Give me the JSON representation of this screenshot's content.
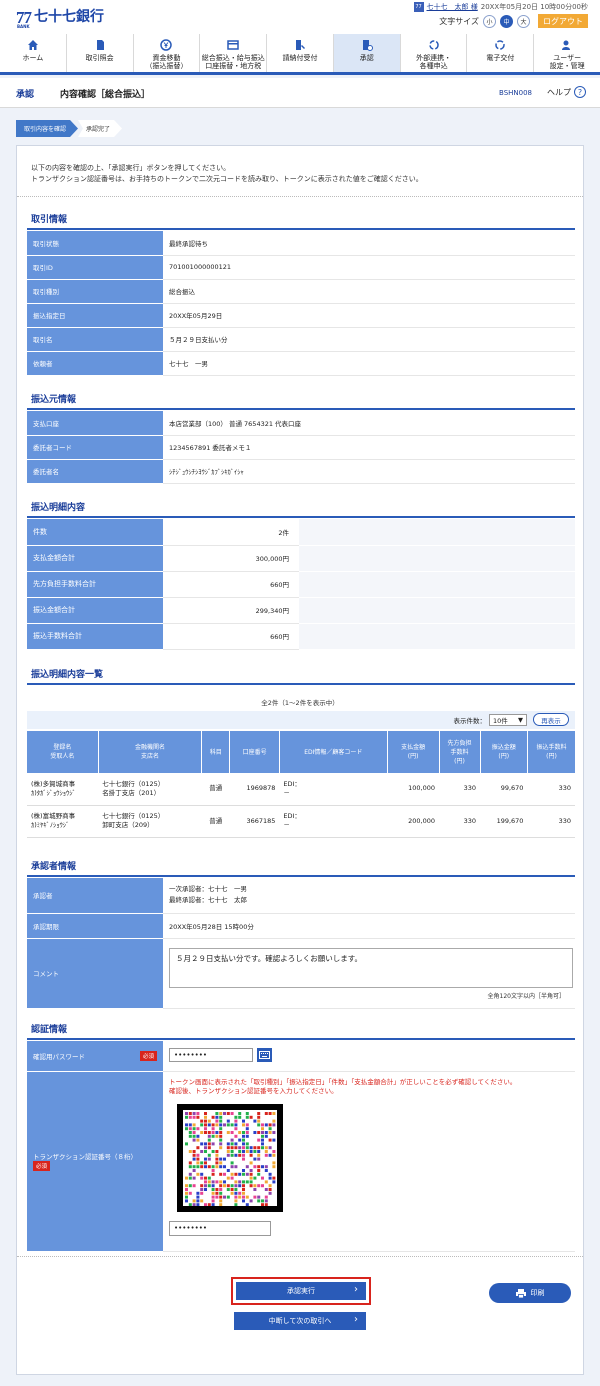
{
  "header": {
    "logo_mark": "77",
    "logo_bank": "BANK",
    "logo_name": "七十七銀行",
    "user_badge": "77",
    "user_name": "七十七　太郎 様",
    "last_login": "20XX年05月20日 10時00分00秒",
    "font_size_label": "文字サイズ",
    "font_small": "小",
    "font_medium": "中",
    "font_large": "大",
    "logout": "ログアウト"
  },
  "nav": [
    {
      "l1": "ホーム",
      "l2": ""
    },
    {
      "l1": "取引照会",
      "l2": ""
    },
    {
      "l1": "資金移動",
      "l2": "（振込振替）"
    },
    {
      "l1": "総合振込・給与振込",
      "l2": "口座振替・地方税"
    },
    {
      "l1": "請納付受付",
      "l2": ""
    },
    {
      "l1": "承認",
      "l2": ""
    },
    {
      "l1": "外部連携・",
      "l2": "各種申込"
    },
    {
      "l1": "電子交付",
      "l2": ""
    },
    {
      "l1": "ユーザー",
      "l2": "設定・管理"
    }
  ],
  "page": {
    "category": "承認",
    "title": "内容確認［総合振込］",
    "code": "BSHN008",
    "help": "ヘルプ",
    "help_icon": "?"
  },
  "steps": [
    "取引内容を確認",
    "承認完了"
  ],
  "intro": [
    "以下の内容を確認の上、「承認実行」ボタンを押してください。",
    "トランザクション認証番号は、お手持ちのトークンで二次元コードを読み取り、トークンに表示された値をご確認ください。"
  ],
  "torihiki": {
    "title": "取引情報",
    "rows": [
      {
        "k": "取引状態",
        "v": "最終承認待ち"
      },
      {
        "k": "取引ID",
        "v": "701001000000121"
      },
      {
        "k": "取引種別",
        "v": "総合振込"
      },
      {
        "k": "振込指定日",
        "v": "20XX年05月29日"
      },
      {
        "k": "取引名",
        "v": "５月２９日支払い分"
      },
      {
        "k": "依頼者",
        "v": "七十七　一男"
      }
    ]
  },
  "moto": {
    "title": "振込元情報",
    "rows": [
      {
        "k": "支払口座",
        "v": "本店営業部（100） 普通 7654321 代表口座"
      },
      {
        "k": "委託者コード",
        "v": "1234567891 委託者メモ１"
      },
      {
        "k": "委託者名",
        "v": "ｼﾁｼﾞｭｳｼﾁｼﾖｳｼﾞｶﾌﾞｼｷｶﾞｲｼｬ"
      }
    ]
  },
  "meisai": {
    "title": "振込明細内容",
    "rows": [
      {
        "k": "件数",
        "v": "2件"
      },
      {
        "k": "支払金額合計",
        "v": "300,000円"
      },
      {
        "k": "先方負担手数料合計",
        "v": "660円"
      },
      {
        "k": "振込金額合計",
        "v": "299,340円"
      },
      {
        "k": "振込手数料合計",
        "v": "660円"
      }
    ]
  },
  "list": {
    "title": "振込明細内容一覧",
    "summary": "全2件（1～2件を表示中）",
    "disp_label": "表示件数：",
    "disp_value": "10件",
    "redisplay": "再表示",
    "headers": [
      {
        "a": "登録名",
        "b": "受取人名"
      },
      {
        "a": "金融機関名",
        "b": "支店名"
      },
      {
        "a": "科目",
        "b": ""
      },
      {
        "a": "口座番号",
        "b": ""
      },
      {
        "a": "EDI情報／顧客コード",
        "b": ""
      },
      {
        "a": "支払金額",
        "b": "(円)"
      },
      {
        "a": "先方負担",
        "b": "手数料",
        "c": "(円)"
      },
      {
        "a": "振込金額",
        "b": "(円)"
      },
      {
        "a": "振込手数料",
        "b": "(円)"
      }
    ],
    "rows": [
      {
        "name1": "(株)多賀城商事",
        "name2": "ｶ)ﾀｶﾞｼﾞｮｳｼｮｳｼﾞ",
        "bank1": "七十七銀行（0125）",
        "bank2": "名掛丁支店（201）",
        "kamoku": "普通",
        "acct": "1969878",
        "edi1": "EDI：",
        "edi2": "－",
        "pay": "100,000",
        "fee_sen": "330",
        "trf": "99,670",
        "fee": "330"
      },
      {
        "name1": "(株)富城野商事",
        "name2": "ｶ)ﾐﾔｷﾞﾉｼｮｳｼﾞ",
        "bank1": "七十七銀行（0125）",
        "bank2": "卸町支店（209）",
        "kamoku": "普通",
        "acct": "3667185",
        "edi1": "EDI：",
        "edi2": "－",
        "pay": "200,000",
        "fee_sen": "330",
        "trf": "199,670",
        "fee": "330"
      }
    ]
  },
  "shonin": {
    "title": "承認者情報",
    "approver_label": "承認者",
    "approver1": "一次承認者：七十七　一男",
    "approver2": "最終承認者：七十七　太郎",
    "deadline_label": "承認期限",
    "deadline": "20XX年05月28日 15時00分",
    "comment_label": "コメント",
    "comment": "５月２９日支払い分です。確認よろしくお願いします。",
    "limit": "全角120文字以内［半角可］"
  },
  "ninsho": {
    "title": "認証情報",
    "pw_label": "確認用パスワード",
    "required": "必須",
    "pw_value": "••••••••",
    "tx_label": "トランザクション認証番号（８桁）",
    "warn1": "トークン画面に表示された「取引種別」「振込指定日」「件数」「支払金額合計」が正しいことを必ず確認してください。",
    "warn2": "確認後、トランザクション認証番号を入力してください。",
    "tx_value": "••••••••"
  },
  "buttons": {
    "approve": "承認実行",
    "suspend": "中断して次の取引へ",
    "print": "印刷",
    "chevron": "›"
  }
}
